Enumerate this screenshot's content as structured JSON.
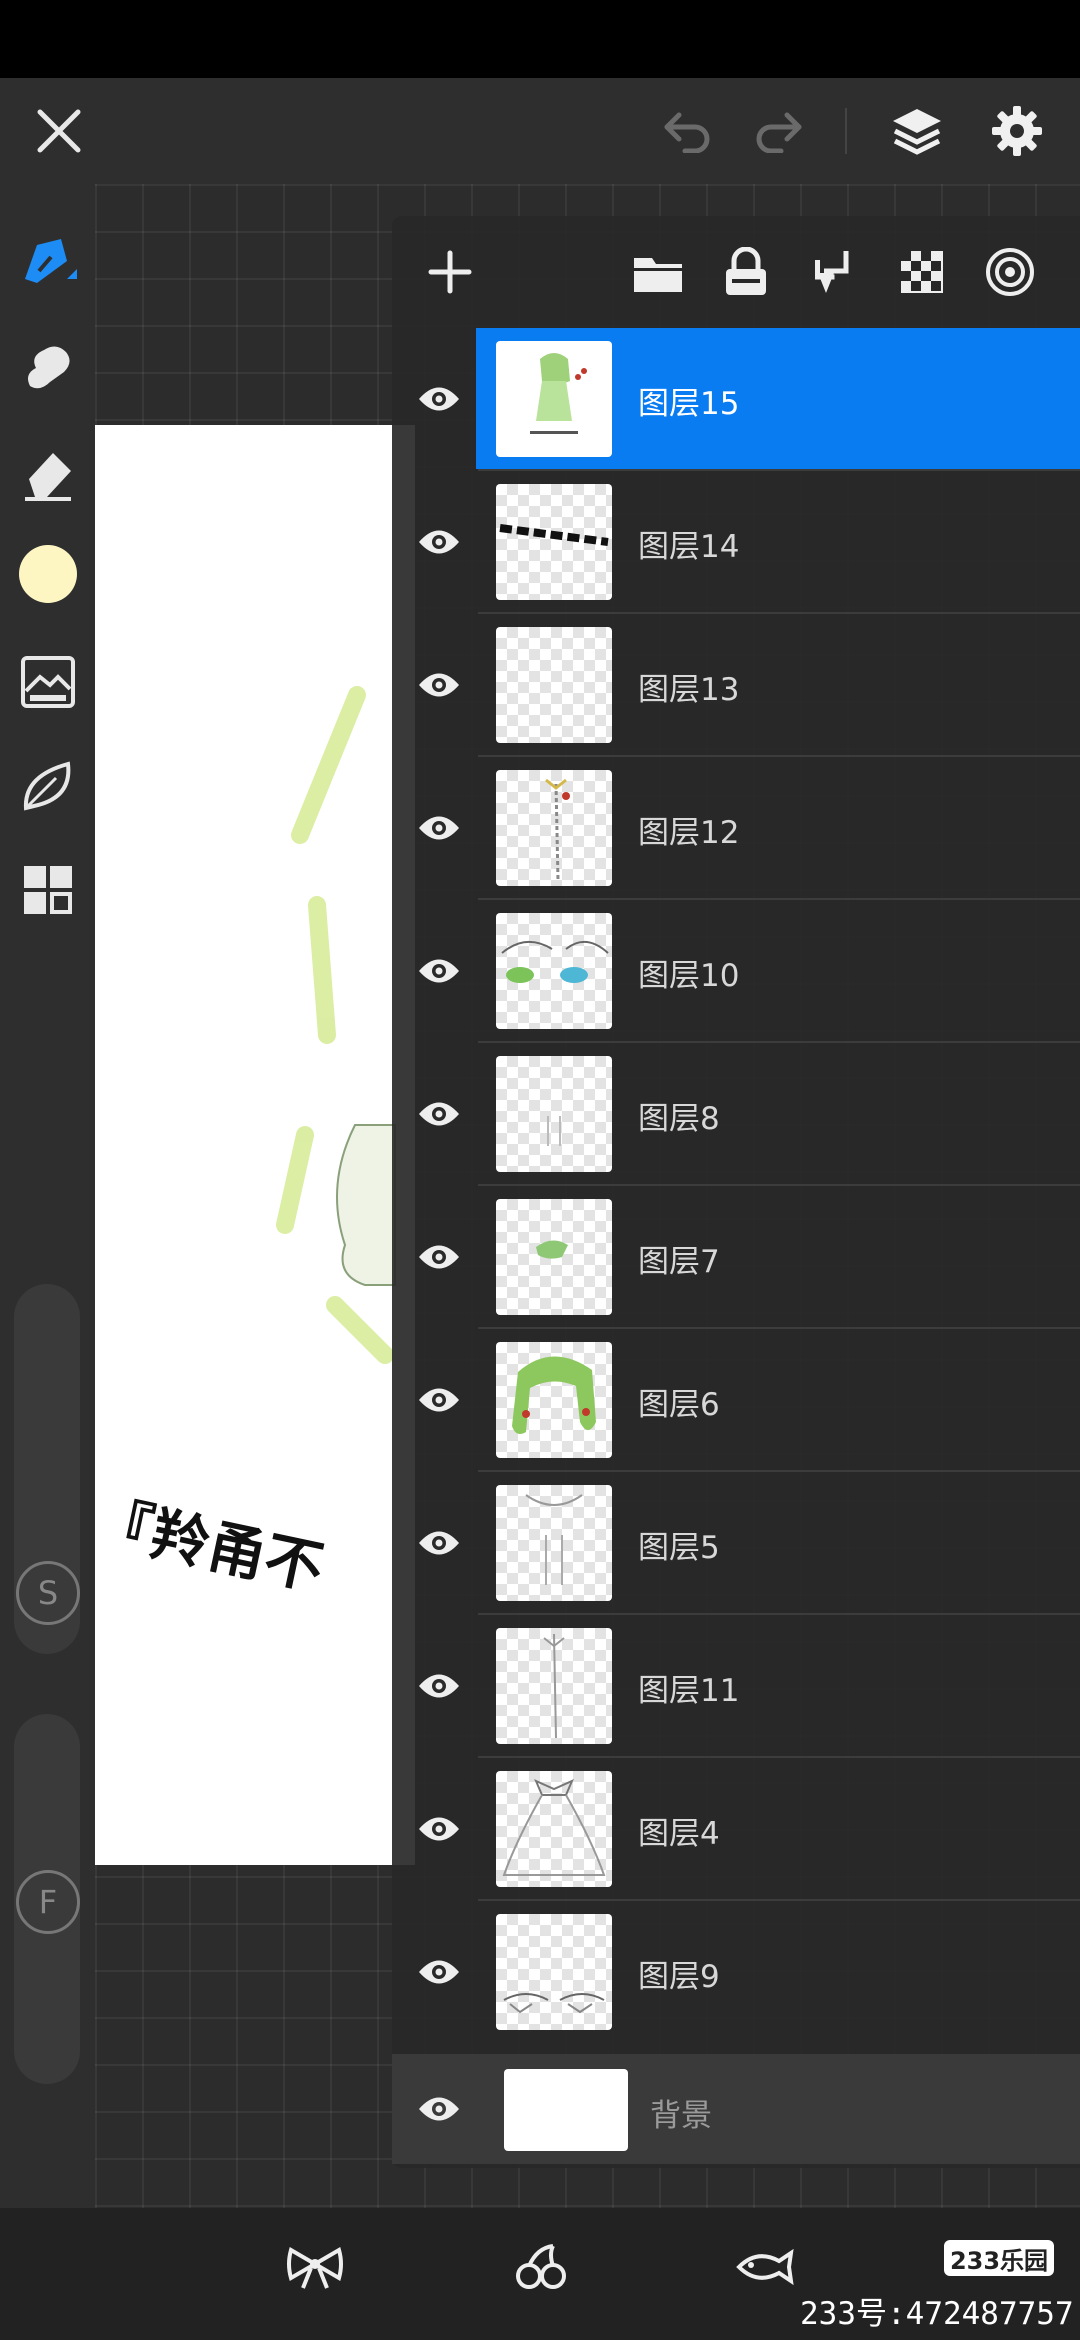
{
  "topbar": {
    "icons": [
      "close-icon",
      "undo-icon",
      "redo-icon",
      "layers-icon",
      "settings-icon"
    ]
  },
  "left_toolbar": {
    "tools": [
      "pen-tool-icon",
      "smudge-tool-icon",
      "eraser-tool-icon",
      "color-swatch",
      "image-adjust-icon",
      "leaf-brush-icon",
      "grid-tool-icon"
    ],
    "color_swatch": "#fdf6c3",
    "size_label": "S",
    "opacity_label": "F"
  },
  "layers_panel": {
    "toolbar_icons": [
      "add-layer-icon",
      "folder-icon",
      "lock-icon",
      "merge-down-icon",
      "alpha-lock-icon",
      "blend-mode-icon"
    ],
    "selected_color": "#0a7cf2",
    "layers": [
      {
        "name": "图层15",
        "selected": true
      },
      {
        "name": "图层14",
        "selected": false
      },
      {
        "name": "图层13",
        "selected": false
      },
      {
        "name": "图层12",
        "selected": false
      },
      {
        "name": "图层10",
        "selected": false
      },
      {
        "name": "图层8",
        "selected": false
      },
      {
        "name": "图层7",
        "selected": false
      },
      {
        "name": "图层6",
        "selected": false
      },
      {
        "name": "图层5",
        "selected": false
      },
      {
        "name": "图层11",
        "selected": false
      },
      {
        "name": "图层4",
        "selected": false
      },
      {
        "name": "图层9",
        "selected": false
      }
    ],
    "background_layer": "背景"
  },
  "artwork": {
    "caption": "『羚甬不"
  },
  "bottombar": {
    "icons": [
      "bow-icon",
      "cherry-icon",
      "fish-icon"
    ]
  },
  "watermark": {
    "logo": "233乐园",
    "id": "233号:472487757"
  }
}
